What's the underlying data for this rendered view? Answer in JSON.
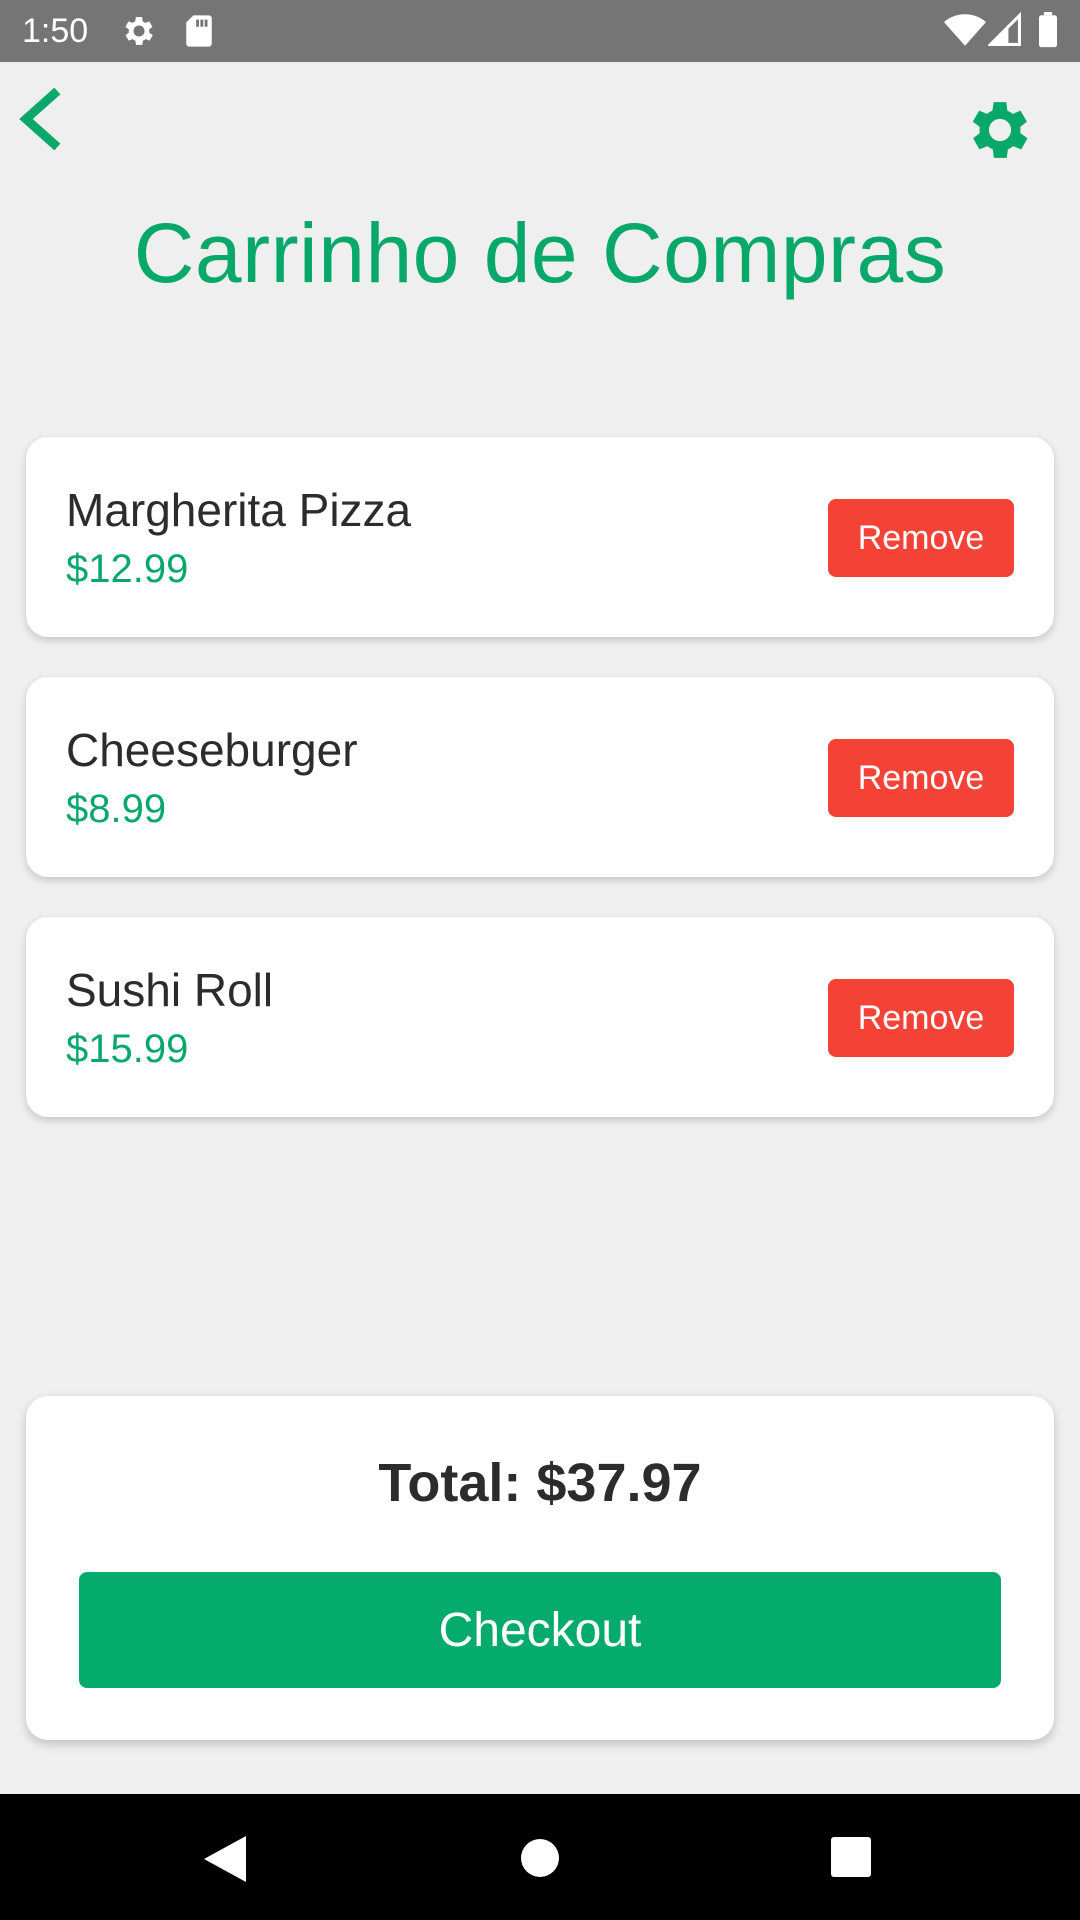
{
  "status_bar": {
    "time": "1:50",
    "icons": [
      "gear-icon",
      "sd-card-icon",
      "wifi-icon",
      "signal-icon",
      "battery-icon"
    ]
  },
  "app_bar": {
    "back_icon": "chevron-left-icon",
    "settings_icon": "gear-icon"
  },
  "title": "Carrinho de Compras",
  "cart": {
    "items": [
      {
        "name": "Margherita Pizza",
        "price": "$12.99",
        "remove_label": "Remove"
      },
      {
        "name": "Cheeseburger",
        "price": "$8.99",
        "remove_label": "Remove"
      },
      {
        "name": "Sushi Roll",
        "price": "$15.99",
        "remove_label": "Remove"
      }
    ]
  },
  "summary": {
    "total": "Total: $37.97",
    "checkout_label": "Checkout"
  },
  "colors": {
    "accent_green": "#07a86a",
    "remove_red": "#f44336",
    "background": "#efefef",
    "status_bar": "#757575"
  },
  "nav_bar": {
    "icons": [
      "nav-back-icon",
      "nav-home-icon",
      "nav-recents-icon"
    ]
  }
}
